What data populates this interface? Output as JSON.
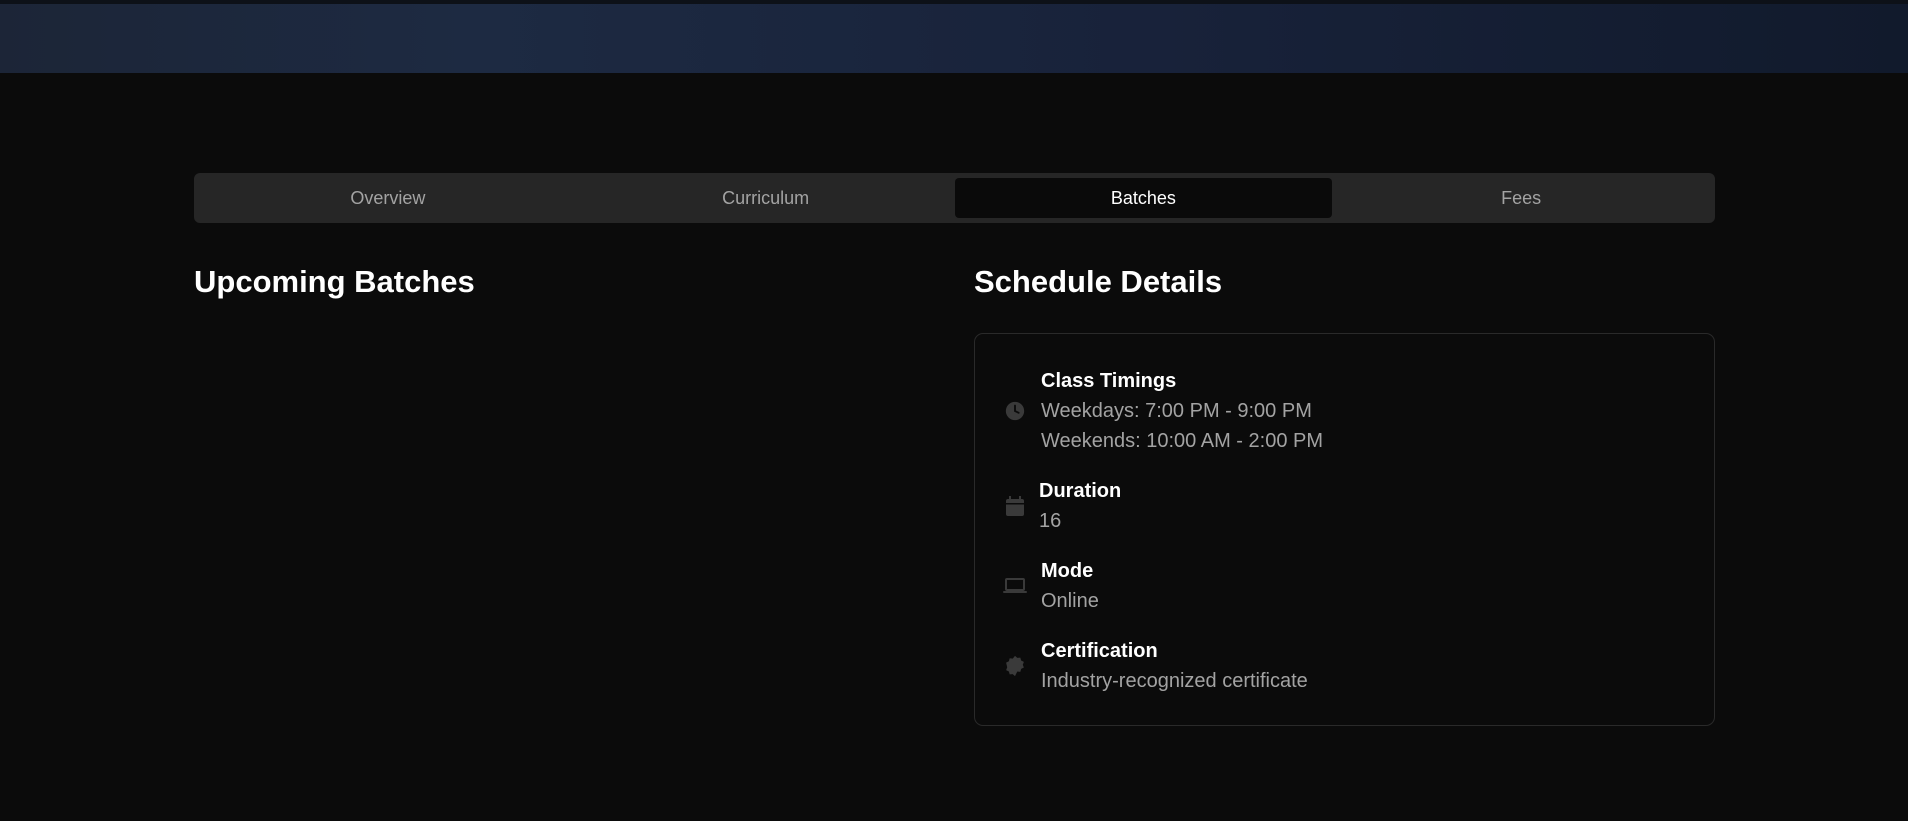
{
  "tabs": [
    {
      "label": "Overview",
      "active": false
    },
    {
      "label": "Curriculum",
      "active": false
    },
    {
      "label": "Batches",
      "active": true
    },
    {
      "label": "Fees",
      "active": false
    }
  ],
  "upcoming": {
    "heading": "Upcoming Batches"
  },
  "schedule": {
    "heading": "Schedule Details",
    "items": [
      {
        "icon": "clock-icon",
        "label": "Class Timings",
        "values": [
          "Weekdays: 7:00 PM - 9:00 PM",
          "Weekends: 10:00 AM - 2:00 PM"
        ]
      },
      {
        "icon": "calendar-icon",
        "label": "Duration",
        "values": [
          "16"
        ]
      },
      {
        "icon": "laptop-icon",
        "label": "Mode",
        "values": [
          "Online"
        ]
      },
      {
        "icon": "badge-icon",
        "label": "Certification",
        "values": [
          "Industry-recognized certificate"
        ]
      }
    ]
  },
  "colors": {
    "background": "#0b0b0b",
    "tab_bar": "#262626",
    "muted_text": "#a3a3a3",
    "icon": "#3a3a3a"
  }
}
